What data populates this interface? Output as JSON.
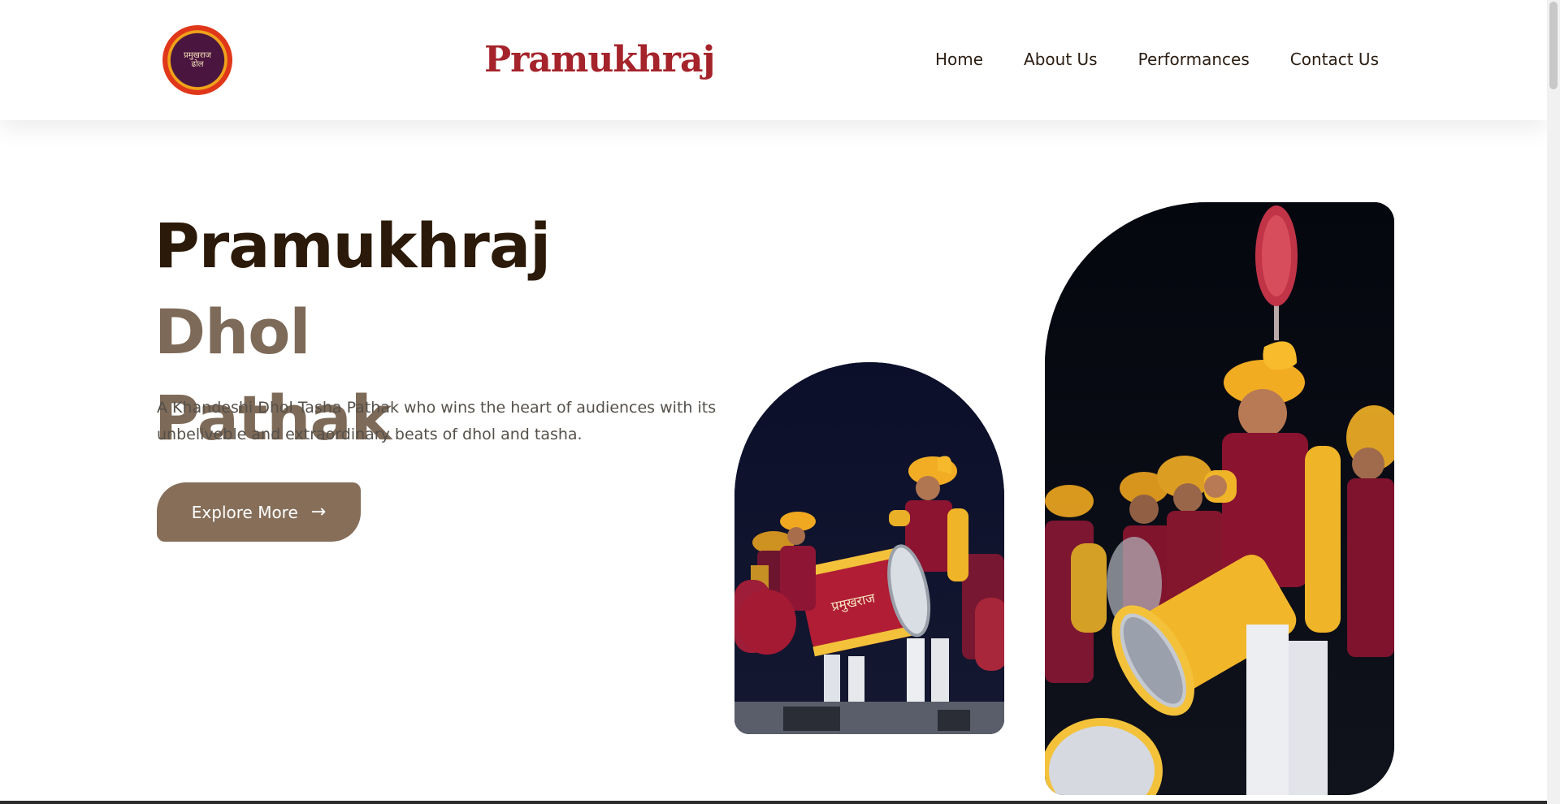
{
  "header": {
    "logo_text": "प्रमुखराज ढोल",
    "brand": "Pramukhraj",
    "nav": [
      "Home",
      "About Us",
      "Performances",
      "Contact Us"
    ]
  },
  "hero": {
    "title_part1": "Pramukhraj",
    "title_part2": "Dhol",
    "title_part3": "Pathak",
    "description": "A Khandeshi Dhol Tasha Pathak who wins the heart of audiences with its unbeliveble and extraordinary beats of dhol and tasha.",
    "cta_label": "Explore More",
    "cta_icon": "→"
  },
  "colors": {
    "brand": "#a5232b",
    "title_dark": "#2b1a09",
    "title_light": "#7d6a58",
    "button": "#866e59"
  },
  "icons": {
    "cta": "arrow-right-icon"
  }
}
